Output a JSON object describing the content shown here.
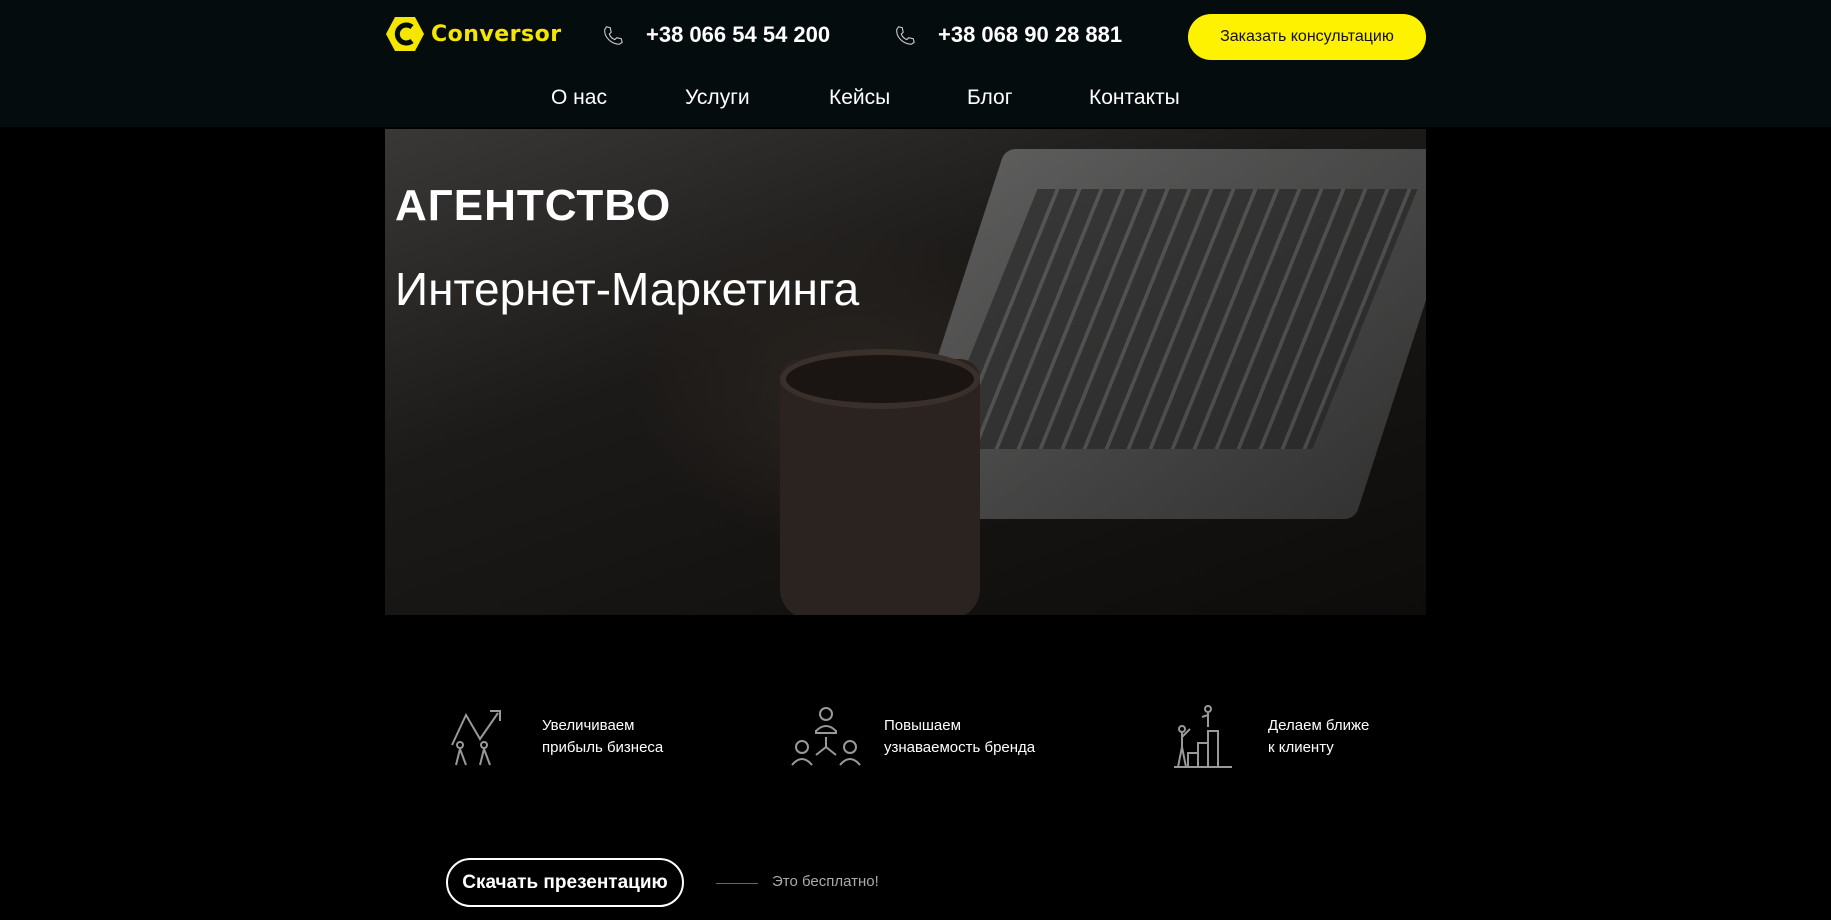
{
  "header": {
    "logo": "Conversor",
    "phones": [
      "+38 066 54 54 200",
      "+38 068 90 28 881"
    ],
    "cta": "Заказать консультацию",
    "nav": [
      "О нас",
      "Услуги",
      "Кейсы",
      "Блог",
      "Контакты"
    ]
  },
  "hero": {
    "title": "АГЕНТСТВО",
    "subtitle": "Интернет-Маркетинга"
  },
  "features": [
    {
      "icon": "growth-arrow-people-icon",
      "line1": "Увеличиваем",
      "line2": "прибыль бизнеса"
    },
    {
      "icon": "network-people-icon",
      "line1": "Повышаем",
      "line2": "узнаваемость бренда"
    },
    {
      "icon": "stairs-helping-icon",
      "line1": "Делаем ближе",
      "line2": "к клиенту"
    }
  ],
  "download": {
    "label": "Скачать презентацию",
    "note": "Это бесплатно!"
  },
  "colors": {
    "accent": "#fff200",
    "header_bg": "#040c0e"
  }
}
